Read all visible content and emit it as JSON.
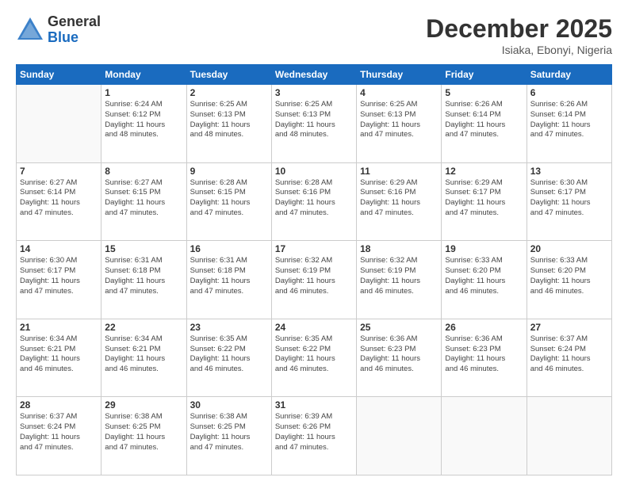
{
  "logo": {
    "general": "General",
    "blue": "Blue"
  },
  "title": "December 2025",
  "location": "Isiaka, Ebonyi, Nigeria",
  "days_header": [
    "Sunday",
    "Monday",
    "Tuesday",
    "Wednesday",
    "Thursday",
    "Friday",
    "Saturday"
  ],
  "weeks": [
    [
      {
        "day": "",
        "info": ""
      },
      {
        "day": "1",
        "info": "Sunrise: 6:24 AM\nSunset: 6:12 PM\nDaylight: 11 hours\nand 48 minutes."
      },
      {
        "day": "2",
        "info": "Sunrise: 6:25 AM\nSunset: 6:13 PM\nDaylight: 11 hours\nand 48 minutes."
      },
      {
        "day": "3",
        "info": "Sunrise: 6:25 AM\nSunset: 6:13 PM\nDaylight: 11 hours\nand 48 minutes."
      },
      {
        "day": "4",
        "info": "Sunrise: 6:25 AM\nSunset: 6:13 PM\nDaylight: 11 hours\nand 47 minutes."
      },
      {
        "day": "5",
        "info": "Sunrise: 6:26 AM\nSunset: 6:14 PM\nDaylight: 11 hours\nand 47 minutes."
      },
      {
        "day": "6",
        "info": "Sunrise: 6:26 AM\nSunset: 6:14 PM\nDaylight: 11 hours\nand 47 minutes."
      }
    ],
    [
      {
        "day": "7",
        "info": "Sunrise: 6:27 AM\nSunset: 6:14 PM\nDaylight: 11 hours\nand 47 minutes."
      },
      {
        "day": "8",
        "info": "Sunrise: 6:27 AM\nSunset: 6:15 PM\nDaylight: 11 hours\nand 47 minutes."
      },
      {
        "day": "9",
        "info": "Sunrise: 6:28 AM\nSunset: 6:15 PM\nDaylight: 11 hours\nand 47 minutes."
      },
      {
        "day": "10",
        "info": "Sunrise: 6:28 AM\nSunset: 6:16 PM\nDaylight: 11 hours\nand 47 minutes."
      },
      {
        "day": "11",
        "info": "Sunrise: 6:29 AM\nSunset: 6:16 PM\nDaylight: 11 hours\nand 47 minutes."
      },
      {
        "day": "12",
        "info": "Sunrise: 6:29 AM\nSunset: 6:17 PM\nDaylight: 11 hours\nand 47 minutes."
      },
      {
        "day": "13",
        "info": "Sunrise: 6:30 AM\nSunset: 6:17 PM\nDaylight: 11 hours\nand 47 minutes."
      }
    ],
    [
      {
        "day": "14",
        "info": "Sunrise: 6:30 AM\nSunset: 6:17 PM\nDaylight: 11 hours\nand 47 minutes."
      },
      {
        "day": "15",
        "info": "Sunrise: 6:31 AM\nSunset: 6:18 PM\nDaylight: 11 hours\nand 47 minutes."
      },
      {
        "day": "16",
        "info": "Sunrise: 6:31 AM\nSunset: 6:18 PM\nDaylight: 11 hours\nand 47 minutes."
      },
      {
        "day": "17",
        "info": "Sunrise: 6:32 AM\nSunset: 6:19 PM\nDaylight: 11 hours\nand 46 minutes."
      },
      {
        "day": "18",
        "info": "Sunrise: 6:32 AM\nSunset: 6:19 PM\nDaylight: 11 hours\nand 46 minutes."
      },
      {
        "day": "19",
        "info": "Sunrise: 6:33 AM\nSunset: 6:20 PM\nDaylight: 11 hours\nand 46 minutes."
      },
      {
        "day": "20",
        "info": "Sunrise: 6:33 AM\nSunset: 6:20 PM\nDaylight: 11 hours\nand 46 minutes."
      }
    ],
    [
      {
        "day": "21",
        "info": "Sunrise: 6:34 AM\nSunset: 6:21 PM\nDaylight: 11 hours\nand 46 minutes."
      },
      {
        "day": "22",
        "info": "Sunrise: 6:34 AM\nSunset: 6:21 PM\nDaylight: 11 hours\nand 46 minutes."
      },
      {
        "day": "23",
        "info": "Sunrise: 6:35 AM\nSunset: 6:22 PM\nDaylight: 11 hours\nand 46 minutes."
      },
      {
        "day": "24",
        "info": "Sunrise: 6:35 AM\nSunset: 6:22 PM\nDaylight: 11 hours\nand 46 minutes."
      },
      {
        "day": "25",
        "info": "Sunrise: 6:36 AM\nSunset: 6:23 PM\nDaylight: 11 hours\nand 46 minutes."
      },
      {
        "day": "26",
        "info": "Sunrise: 6:36 AM\nSunset: 6:23 PM\nDaylight: 11 hours\nand 46 minutes."
      },
      {
        "day": "27",
        "info": "Sunrise: 6:37 AM\nSunset: 6:24 PM\nDaylight: 11 hours\nand 46 minutes."
      }
    ],
    [
      {
        "day": "28",
        "info": "Sunrise: 6:37 AM\nSunset: 6:24 PM\nDaylight: 11 hours\nand 47 minutes."
      },
      {
        "day": "29",
        "info": "Sunrise: 6:38 AM\nSunset: 6:25 PM\nDaylight: 11 hours\nand 47 minutes."
      },
      {
        "day": "30",
        "info": "Sunrise: 6:38 AM\nSunset: 6:25 PM\nDaylight: 11 hours\nand 47 minutes."
      },
      {
        "day": "31",
        "info": "Sunrise: 6:39 AM\nSunset: 6:26 PM\nDaylight: 11 hours\nand 47 minutes."
      },
      {
        "day": "",
        "info": ""
      },
      {
        "day": "",
        "info": ""
      },
      {
        "day": "",
        "info": ""
      }
    ]
  ]
}
